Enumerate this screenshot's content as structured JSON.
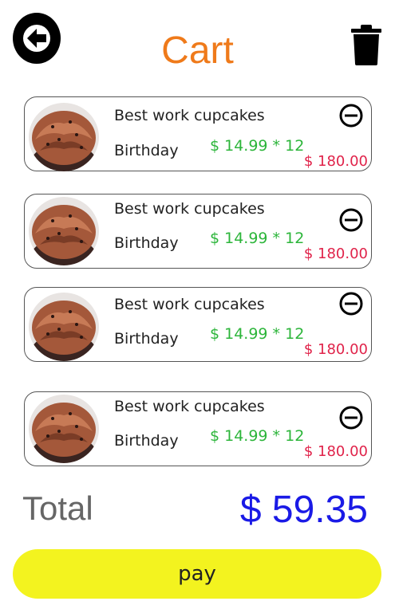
{
  "header": {
    "title": "Cart",
    "back_icon": "arrow-left-icon",
    "delete_icon": "trash-icon",
    "title_color": "#ef7a1a"
  },
  "items": [
    {
      "name": "Best work cupcakes",
      "tag": "Birthday",
      "price": "$ 14.99 * 12",
      "total": "$ 180.00",
      "remove_icon": "minus-circle-icon"
    },
    {
      "name": "Best work cupcakes",
      "tag": "Birthday",
      "price": "$ 14.99 * 12",
      "total": "$ 180.00",
      "remove_icon": "minus-circle-icon"
    },
    {
      "name": "Best work cupcakes",
      "tag": "Birthday",
      "price": "$ 14.99 * 12",
      "total": "$ 180.00",
      "remove_icon": "minus-circle-icon"
    },
    {
      "name": "Best work cupcakes",
      "tag": "Birthday",
      "price": "$ 14.99 * 12",
      "total": "$ 180.00",
      "remove_icon": "minus-circle-icon"
    }
  ],
  "summary": {
    "label": "Total",
    "value": "$ 59.35",
    "value_color": "#1a1ae6"
  },
  "pay_button": {
    "label": "pay",
    "color": "#f3f31f"
  }
}
